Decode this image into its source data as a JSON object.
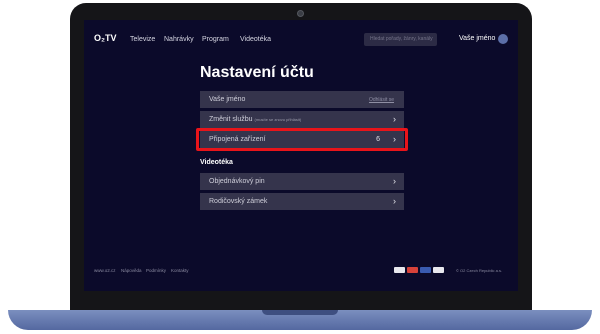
{
  "header": {
    "logo": "O₂TV",
    "nav": [
      "Televize",
      "Nahrávky",
      "Program",
      "Videotéka"
    ],
    "search_placeholder": "Hledat pořady, žánry, kanály",
    "username": "Vaše jméno"
  },
  "page": {
    "title": "Nastavení účtu",
    "account_row": {
      "label": "Vaše jméno",
      "signout": "Odhlásit se"
    },
    "rows": [
      {
        "label": "Změnit službu",
        "note": "(musíte se znovu přihlásit)"
      },
      {
        "label": "Připojená zařízení",
        "count": "6"
      }
    ],
    "section_title": "Videotéka",
    "videoteka_rows": [
      {
        "label": "Objednávkový pin"
      },
      {
        "label": "Rodičovský zámek"
      }
    ],
    "chevron": "›"
  },
  "footer": {
    "links": [
      "www.o2.cz",
      "Nápověda",
      "Podmínky",
      "Kontakty"
    ],
    "copyright": "© O2 Czech Republic a.s."
  },
  "colors": {
    "background": "#0b0a2a",
    "row": "#35344c",
    "highlight": "#e8141a",
    "laptop_base": "#6a7db2"
  }
}
